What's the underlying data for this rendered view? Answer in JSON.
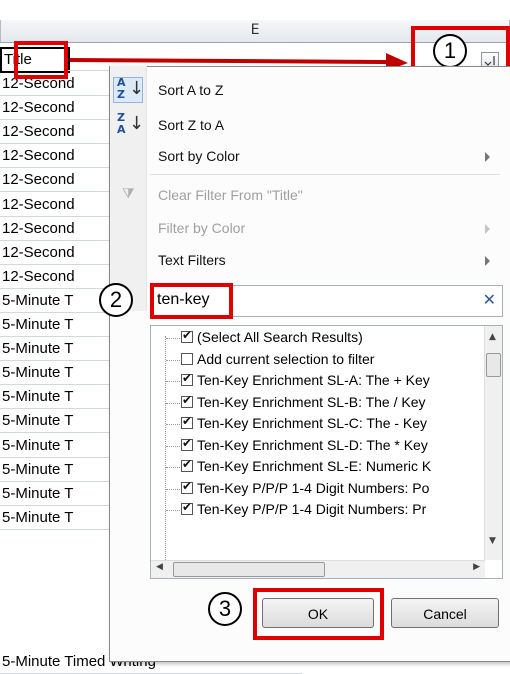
{
  "sheet": {
    "column_letter": "E",
    "header_cell": "Title",
    "rows": [
      "12-Second",
      "12-Second",
      "12-Second",
      "12-Second",
      "12-Second",
      "12-Second",
      "12-Second",
      "12-Second",
      "12-Second",
      "5-Minute T",
      "5-Minute T",
      "5-Minute T",
      "5-Minute T",
      "5-Minute T",
      "5-Minute T",
      "5-Minute T",
      "5-Minute T",
      "5-Minute T",
      "5-Minute T"
    ],
    "last_row": "5-Minute Timed Writing"
  },
  "callouts": {
    "one": "1",
    "two": "2",
    "three": "3"
  },
  "menu": {
    "sort_az": "Sort A to Z",
    "sort_za": "Sort Z to A",
    "sort_color": "Sort by Color",
    "clear_filter": "Clear Filter From \"Title\"",
    "filter_color": "Filter by Color",
    "text_filters": "Text Filters"
  },
  "search": {
    "value": "ten-key",
    "clear_icon": "✕"
  },
  "list": [
    {
      "label": "(Select All Search Results)",
      "checked": true
    },
    {
      "label": "Add current selection to filter",
      "checked": false
    },
    {
      "label": "Ten-Key Enrichment SL-A: The + Key",
      "checked": true
    },
    {
      "label": "Ten-Key Enrichment SL-B: The / Key",
      "checked": true
    },
    {
      "label": "Ten-Key Enrichment SL-C: The - Key",
      "checked": true
    },
    {
      "label": "Ten-Key Enrichment SL-D: The * Key",
      "checked": true
    },
    {
      "label": "Ten-Key Enrichment SL-E: Numeric K",
      "checked": true
    },
    {
      "label": "Ten-Key P/P/P 1-4 Digit Numbers: Po",
      "checked": true
    },
    {
      "label": "Ten-Key P/P/P 1-4 Digit Numbers: Pr",
      "checked": true
    }
  ],
  "buttons": {
    "ok": "OK",
    "cancel": "Cancel"
  },
  "colors": {
    "callout_red": "#e00000",
    "arrow_red": "#c00000"
  }
}
